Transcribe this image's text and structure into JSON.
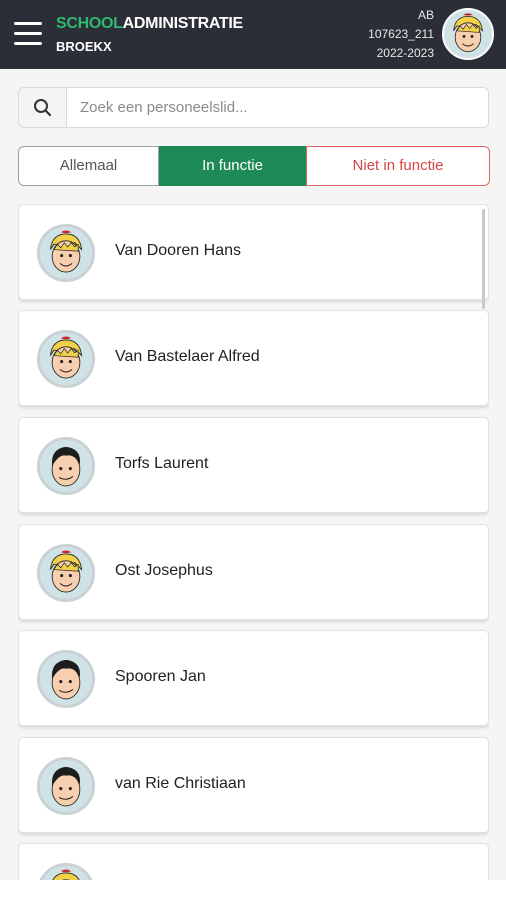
{
  "header": {
    "brand_accent": "SCHOOL",
    "brand_main": "ADMINISTRATIE",
    "school_name": "BROEKX",
    "user_initials": "AB",
    "user_code": "107623_211",
    "school_year": "2022-2023"
  },
  "search": {
    "placeholder": "Zoek een personeelslid..."
  },
  "tabs": {
    "all": "Allemaal",
    "active": "In functie",
    "inactive": "Niet in functie"
  },
  "staff": [
    {
      "name": "Van Dooren Hans",
      "avatar": "girl-avatar-icon"
    },
    {
      "name": "Van Bastelaer Alfred",
      "avatar": "girl-avatar-icon"
    },
    {
      "name": "Torfs Laurent",
      "avatar": "boy-avatar-icon"
    },
    {
      "name": "Ost Josephus",
      "avatar": "girl-avatar-icon"
    },
    {
      "name": "Spooren Jan",
      "avatar": "boy-avatar-icon"
    },
    {
      "name": "van Rie Christiaan",
      "avatar": "boy-avatar-icon"
    },
    {
      "name": "",
      "avatar": "girl-avatar-icon"
    }
  ],
  "colors": {
    "header_bg": "#2b2e36",
    "accent": "#2fb870",
    "active_tab": "#1e8a55",
    "inactive_tab": "#d64545"
  }
}
